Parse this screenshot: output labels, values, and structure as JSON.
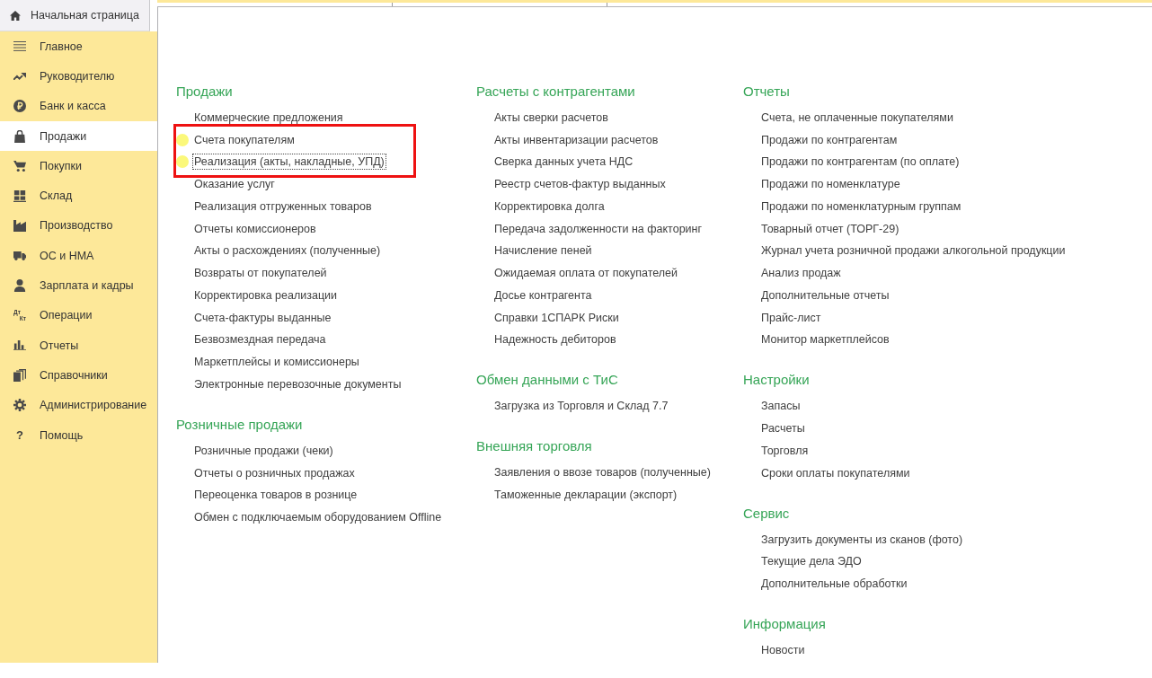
{
  "home_tab": {
    "label": "Начальная страница"
  },
  "sidebar": {
    "items": [
      {
        "label": "Главное",
        "selected": false
      },
      {
        "label": "Руководителю",
        "selected": false
      },
      {
        "label": "Банк и касса",
        "selected": false
      },
      {
        "label": "Продажи",
        "selected": true
      },
      {
        "label": "Покупки",
        "selected": false
      },
      {
        "label": "Склад",
        "selected": false
      },
      {
        "label": "Производство",
        "selected": false
      },
      {
        "label": "ОС и НМА",
        "selected": false
      },
      {
        "label": "Зарплата и кадры",
        "selected": false
      },
      {
        "label": "Операции",
        "selected": false,
        "icon_text": [
          "Дт",
          "Кт"
        ]
      },
      {
        "label": "Отчеты",
        "selected": false
      },
      {
        "label": "Справочники",
        "selected": false
      },
      {
        "label": "Администрирование",
        "selected": false
      },
      {
        "label": "Помощь",
        "selected": false,
        "icon_text": [
          "?"
        ]
      }
    ]
  },
  "columns": [
    {
      "sections": [
        {
          "title": "Продажи",
          "items": [
            {
              "label": "Коммерческие предложения",
              "marked": false,
              "framed": false,
              "focused": false
            },
            {
              "label": "Счета покупателям",
              "marked": true,
              "framed": true,
              "focused": false
            },
            {
              "label": "Реализация (акты, накладные, УПД)",
              "marked": true,
              "framed": true,
              "focused": true
            },
            {
              "label": "Оказание услуг",
              "marked": false,
              "framed": false,
              "focused": false
            },
            {
              "label": "Реализация отгруженных товаров",
              "marked": false,
              "framed": false,
              "focused": false
            },
            {
              "label": "Отчеты комиссионеров",
              "marked": false,
              "framed": false,
              "focused": false
            },
            {
              "label": "Акты о расхождениях (полученные)",
              "marked": false,
              "framed": false,
              "focused": false
            },
            {
              "label": "Возвраты от покупателей",
              "marked": false,
              "framed": false,
              "focused": false
            },
            {
              "label": "Корректировка реализации",
              "marked": false,
              "framed": false,
              "focused": false
            },
            {
              "label": "Счета-фактуры выданные",
              "marked": false,
              "framed": false,
              "focused": false
            },
            {
              "label": "Безвозмездная передача",
              "marked": false,
              "framed": false,
              "focused": false
            },
            {
              "label": "Маркетплейсы и комиссионеры",
              "marked": false,
              "framed": false,
              "focused": false
            },
            {
              "label": "Электронные перевозочные документы",
              "marked": false,
              "framed": false,
              "focused": false
            }
          ]
        },
        {
          "title": "Розничные продажи",
          "items": [
            {
              "label": "Розничные продажи (чеки)"
            },
            {
              "label": "Отчеты о розничных продажах"
            },
            {
              "label": "Переоценка товаров в рознице"
            },
            {
              "label": "Обмен с подключаемым оборудованием Offline"
            }
          ]
        }
      ]
    },
    {
      "sections": [
        {
          "title": "Расчеты с контрагентами",
          "items": [
            {
              "label": "Акты сверки расчетов"
            },
            {
              "label": "Акты инвентаризации расчетов"
            },
            {
              "label": "Сверка данных учета НДС"
            },
            {
              "label": "Реестр счетов-фактур выданных"
            },
            {
              "label": "Корректировка долга"
            },
            {
              "label": "Передача задолженности на факторинг"
            },
            {
              "label": "Начисление пеней"
            },
            {
              "label": "Ожидаемая оплата от покупателей"
            },
            {
              "label": "Досье контрагента"
            },
            {
              "label": "Справки 1СПАРК Риски"
            },
            {
              "label": "Надежность дебиторов"
            }
          ]
        },
        {
          "title": "Обмен данными с ТиС",
          "items": [
            {
              "label": "Загрузка из Торговля и Склад 7.7"
            }
          ]
        },
        {
          "title": "Внешняя торговля",
          "items": [
            {
              "label": "Заявления о ввозе товаров (полученные)"
            },
            {
              "label": "Таможенные декларации (экспорт)"
            }
          ]
        }
      ]
    },
    {
      "sections": [
        {
          "title": "Отчеты",
          "items": [
            {
              "label": "Счета, не оплаченные покупателями"
            },
            {
              "label": "Продажи по контрагентам"
            },
            {
              "label": "Продажи по контрагентам (по оплате)"
            },
            {
              "label": "Продажи по номенклатуре"
            },
            {
              "label": "Продажи по номенклатурным группам"
            },
            {
              "label": "Товарный отчет (ТОРГ-29)"
            },
            {
              "label": "Журнал учета розничной продажи алкогольной продукции"
            },
            {
              "label": "Анализ продаж"
            },
            {
              "label": "Дополнительные отчеты"
            },
            {
              "label": "Прайс-лист"
            },
            {
              "label": "Монитор маркетплейсов"
            }
          ]
        },
        {
          "title": "Настройки",
          "items": [
            {
              "label": "Запасы"
            },
            {
              "label": "Расчеты"
            },
            {
              "label": "Торговля"
            },
            {
              "label": "Сроки оплаты покупателями"
            }
          ]
        },
        {
          "title": "Сервис",
          "items": [
            {
              "label": "Загрузить документы из сканов (фото)"
            },
            {
              "label": "Текущие дела ЭДО"
            },
            {
              "label": "Дополнительные обработки"
            }
          ]
        },
        {
          "title": "Информация",
          "items": [
            {
              "label": "Новости"
            }
          ]
        }
      ]
    }
  ]
}
